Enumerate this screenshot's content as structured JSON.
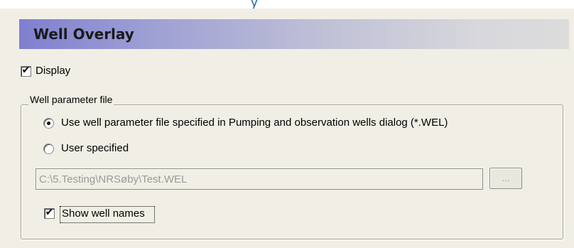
{
  "header": {
    "title": "Well Overlay"
  },
  "display": {
    "label": "Display",
    "checked": true
  },
  "well_parameter_file": {
    "legend": "Well parameter file",
    "options": [
      {
        "label": "Use well parameter file specified in Pumping and observation wells dialog (*.WEL)",
        "selected": true
      },
      {
        "label": "User specified",
        "selected": false
      }
    ],
    "path_value": "C:\\5.Testing\\NRSøby\\Test.WEL",
    "browse_label": "...",
    "show_names": {
      "label": "Show well names",
      "checked": true
    }
  },
  "colors": {
    "panel_background": "#f1efe5",
    "header_gradient_start": "#7f7fcf",
    "header_gradient_end": "#dcdcdc",
    "disabled_text": "#9a9a9a",
    "top_partial_text": "#3a78a8"
  },
  "icons": {
    "check": "checkmark-icon",
    "radio_selected": "radio-dot-icon"
  },
  "top_partial_text": "y"
}
